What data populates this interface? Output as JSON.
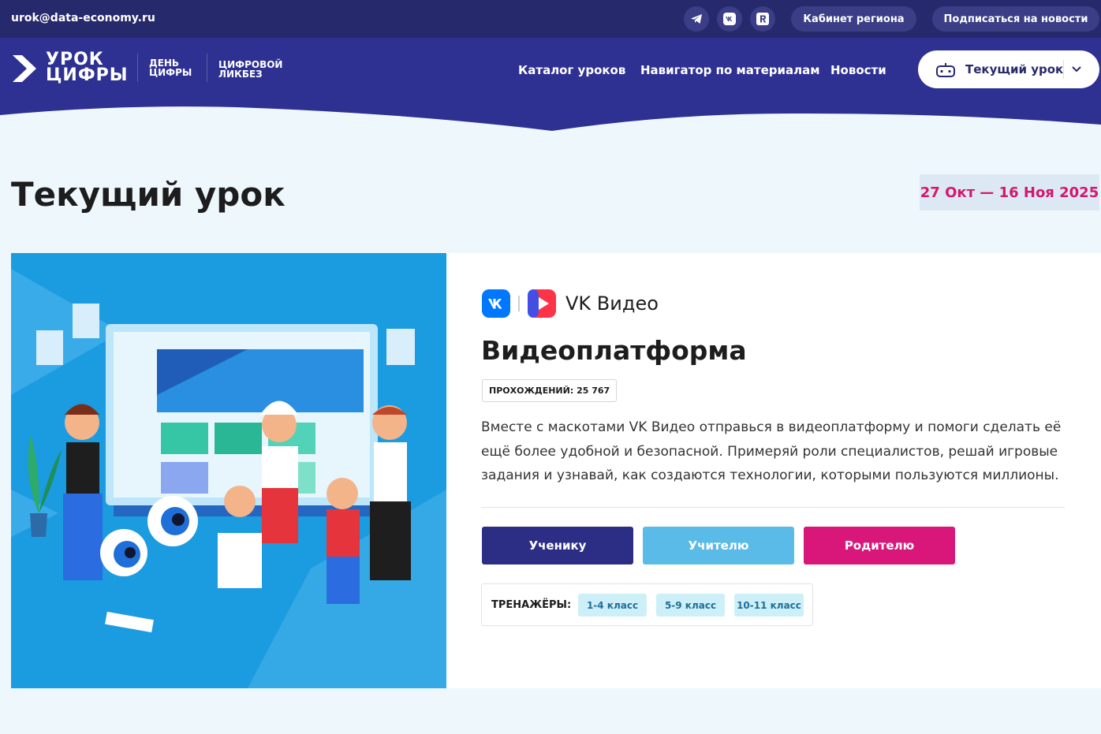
{
  "topbar": {
    "email": "urok@data-economy.ru",
    "social": [
      {
        "name": "telegram-icon"
      },
      {
        "name": "vk-icon"
      },
      {
        "name": "rutube-icon"
      }
    ],
    "region_button": "Кабинет региона",
    "subscribe_button": "Подписаться на новости"
  },
  "header": {
    "logo_line1": "УРОК",
    "logo_line2": "ЦИФРЫ",
    "sub1_line1": "ДЕНЬ",
    "sub1_line2": "ЦИФРЫ",
    "sub2_line1": "ЦИФРОВОЙ",
    "sub2_line2": "ЛИКБЕЗ",
    "nav": [
      "Каталог уроков",
      "Навигатор по материалам",
      "Новости"
    ],
    "current_lesson_button": "Текущий урок"
  },
  "page": {
    "title": "Текущий урок",
    "date_range": "27 Окт — 16 Ноя 2025"
  },
  "lesson": {
    "brand_name": "VK Видео",
    "title": "Видеоплатформа",
    "completions": "ПРОХОЖДЕНИЙ: 25 767",
    "description": "Вместе с маскотами VK Видео отправься в видеоплатформу и помоги сделать её ещё более удобной и безопасной. Примеряй роли специалистов, решай игровые задания и узнавай, как создаются технологии, которыми пользуются миллионы.",
    "roles": [
      {
        "label": "Ученику",
        "color": "#2c2e86"
      },
      {
        "label": "Учителю",
        "color": "#5bbbe8"
      },
      {
        "label": "Родителю",
        "color": "#d9177a"
      }
    ],
    "trainers_label": "ТРЕНАЖЁРЫ:",
    "trainers": [
      "1-4 класс",
      "5-9 класс",
      "10-11 класс"
    ]
  },
  "colors": {
    "topbar": "#26296b",
    "header": "#2e3192",
    "accent_pink": "#d4176f",
    "page_bg": "#eef8fc"
  }
}
